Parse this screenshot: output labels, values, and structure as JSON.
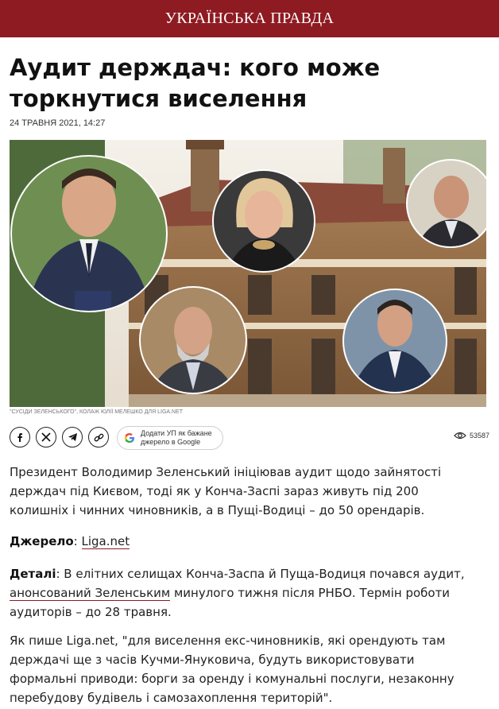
{
  "header": {
    "logo": "УКРАЇНСЬКА ПРАВДА"
  },
  "article": {
    "title": "Аудит держдач: кого може торкнутися виселення",
    "date": "24 ТРАВНЯ 2021, 14:27",
    "image_caption": "\"СУСІДИ ЗЕЛЕНСЬКОГО\", КОЛАЖ ЮЛІЇ МЕЛЕШКО ДЛЯ LIGA.NET",
    "lead": "Президент Володимир Зеленський ініціював аудит щодо зайнятості держдач під Києвом, тоді як у Конча-Заспі зараз живуть під 200 колишніх і чинних чиновників, а в Пущі-Водиці – до 50 орендарів.",
    "source_label": "Джерело",
    "source_sep": ": ",
    "source_link": "Liga.net",
    "details_label": "Деталі",
    "details_text1": ": В елітних селищах Конча-Заспа й Пуща-Водиця почався аудит, ",
    "details_link": "анонсований Зеленським",
    "details_text2": " минулого тижня після РНБО. Термін роботи аудиторів – до 28 травня.",
    "quote_para": "Як пише Liga.net, \"для виселення екс-чиновників, які орендують там держдачі ще з часів Кучми-Януковича, будуть використовувати формальні приводи: борги за оренду і комунальні послуги, незаконну перебудову будівель і самозахоплення територій\"."
  },
  "share": {
    "buttons": [
      {
        "icon": "facebook-icon"
      },
      {
        "icon": "x-icon"
      },
      {
        "icon": "telegram-icon"
      },
      {
        "icon": "link-icon"
      }
    ],
    "google_label": "Додати УП як бажане джерело в Google",
    "views": "53587"
  },
  "colors": {
    "brand": "#8e1a22",
    "text": "#222222"
  }
}
